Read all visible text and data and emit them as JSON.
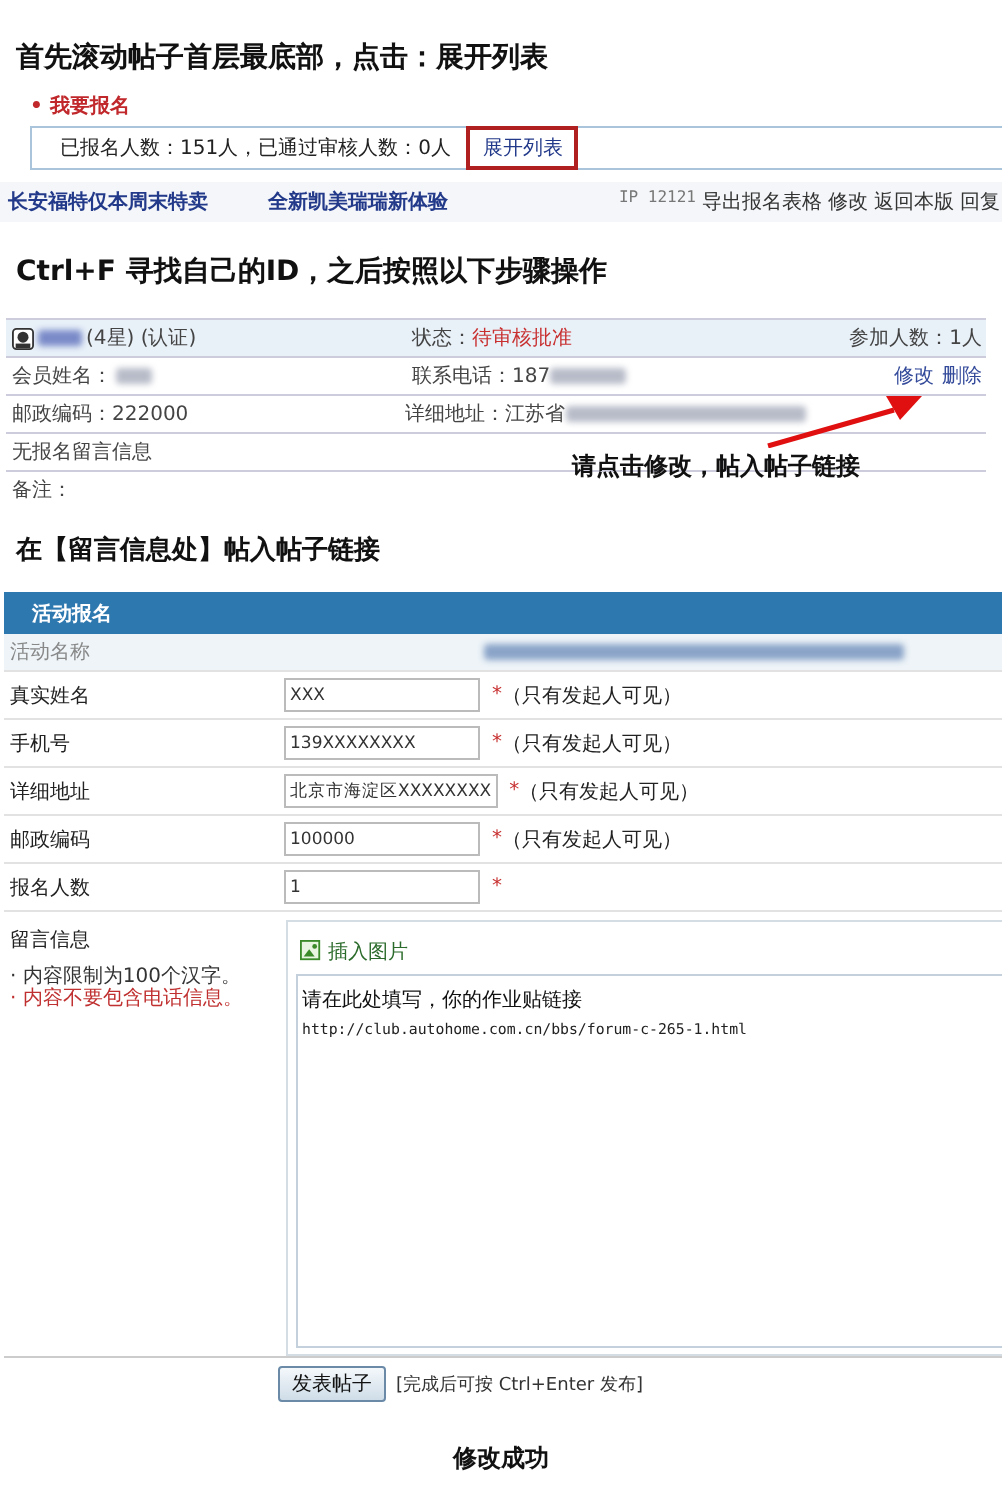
{
  "step1_heading": "首先滚动帖子首层最底部，点击：展开列表",
  "signup": {
    "title": "• 我要报名",
    "summary": "已报名人数：151人，已通过审核人数：0人",
    "expand_button": {
      "label": "展开列表",
      "highlighted": true
    }
  },
  "link_bar": {
    "links": [
      "长安福特仅本周末特卖",
      "全新凯美瑞瑞新体验"
    ],
    "ip": "IP 12121",
    "actions": [
      "导出报名表格",
      "修改",
      "返回本版",
      "回复"
    ]
  },
  "step2_heading": "Ctrl+F 寻找自己的ID，之后按照以下步骤操作",
  "registrant": {
    "rank": "(4星) (认证)",
    "status_label": "状态：",
    "status": "待审核批准",
    "count": "参加人数：1人",
    "name_label": "会员姓名：",
    "phone_label": "联系电话：",
    "phone_visible": "187",
    "actions": [
      "修改",
      "删除"
    ],
    "postcode": "邮政编码：222000",
    "address_label": "详细地址：",
    "address_visible": "江苏省",
    "message": "无报名留言信息",
    "remark": "备注："
  },
  "annotation": "请点击修改，帖入帖子链接",
  "step3_heading": "在【留言信息处】帖入帖子链接",
  "form": {
    "title": "活动报名",
    "activity_label": "活动名称",
    "fields": [
      {
        "label": "真实姓名",
        "value": "XXX",
        "mark": "*",
        "note": "（只有发起人可见）"
      },
      {
        "label": "手机号",
        "value": "139XXXXXXXX",
        "mark": "*",
        "note": "（只有发起人可见）"
      },
      {
        "label": "详细地址",
        "value": "北京市海淀区XXXXXXXX",
        "mark": "*",
        "note": "（只有发起人可见）"
      },
      {
        "label": "邮政编码",
        "value": "100000",
        "mark": "*",
        "note": "（只有发起人可见）"
      },
      {
        "label": "报名人数",
        "value": "1",
        "mark": "*"
      }
    ],
    "message": {
      "label": "留言信息",
      "hints": [
        {
          "text": "· 内容限制为100个汉字。",
          "warning": false
        },
        {
          "text": "· 内容不要包含电话信息。",
          "warning": true
        }
      ],
      "insert_image": "插入图片",
      "lines": [
        "请在此处填写，你的作业贴链接",
        "http://club.autohome.com.cn/bbs/forum-c-265-1.html"
      ]
    },
    "submit": {
      "label": "发表帖子",
      "hint": "[完成后可按 Ctrl+Enter 发布]"
    }
  },
  "result": "修改成功"
}
